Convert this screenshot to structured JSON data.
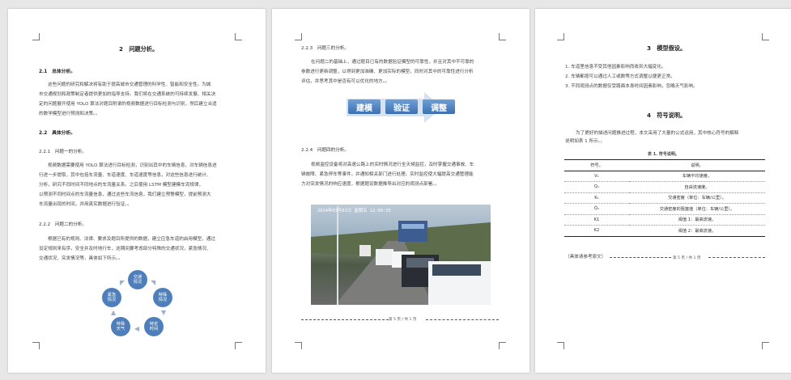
{
  "page1": {
    "h_analysis": "2　问题分析。",
    "s21": "2.1　总体分析。",
    "s21_lines": [
      "这些问题的研究和解决将有助于提高城市交通管理的科学性、智能和安全性。为城",
      "市交通规划和政策制定者提供更加的指导支持。我们将在交通系统的可持续发展、相关决",
      "定的问题展开使用 YOLO 算法对题目附录的视频数据进行目标检测与识别，然后建立合适",
      "的数学模型进行预测和决策。。"
    ],
    "s22": "2.2　具体分析。",
    "s221": "2.2.1　问题一的分析。",
    "s221_lines": [
      "视频数据需要使用 YOLO 算法进行目标检测，识别出其中的车辆信息，对车辆信息进",
      "行进一步提取，其中包括车流量、车道速度、车道速度等信息，对这些信息进行统计、",
      "分析，研究不同时间不同地点的车流量关系。之后使用 LSTM 模型建模车流规律，",
      "以预测不同时间点的车流量信息，通过这些车流信息，我们建立预警模型，提前预测大",
      "车流量出现的时间，并用真实数据进行验证。。"
    ],
    "s222": "2.2.2　问题二的分析。",
    "s222_lines": [
      "根据已有的规则、法律、要求及题目所提供的数据，建立应急车道的启用模型，通过",
      "设定规则来有序，安全并及时地行车，这期间要考虑部分特殊的交通状况，紧急情况、",
      "交通状况、突发情况等，具体如下所示。。"
    ],
    "cycle": [
      {
        "label": "交通\n情况"
      },
      {
        "label": "特殊\n情况"
      },
      {
        "label": "特定\n时间"
      },
      {
        "label": "特殊\n天气"
      },
      {
        "label": "紧急\n情况"
      }
    ]
  },
  "page2": {
    "s223": "2.2.3　问题三的分析。",
    "s223_lines": [
      "在问题二的基础上，通过题目已有的数据验证模型的可靠性，并且对其中不可靠的",
      "参数进行更新调整，以得到更加准确、更加实际的模型，同时对其中的可靠性进行分析",
      "评估，并思考其中是否有可以优化的地方。。"
    ],
    "flow": [
      "建模",
      "验证",
      "调整"
    ],
    "s224": "2.2.4　问题四的分析。",
    "s224_lines": [
      "视频监控设备将对高速公路上的实时情况进行全天候监控，及时掌握交通事故、车",
      "辆故障、紧急停车等事件，并通知相关部门进行处理。实时监控使大幅提高交通管理能",
      "力对突发情况的响应速度，根据题设数据推导出对应的观测点部署。。"
    ],
    "photo_stamp": "2024年03月01日 星期五 12:09:35",
    "footer": "第 5 页 / 共 1 页"
  },
  "page3": {
    "h_assume": "3　模型假设。",
    "assumptions": [
      "1. 车道里信息不受其他因素影响而收到大幅变化。",
      "2. 车辆都按可以通过人工或数等方式调整以便更正常。",
      "3. 不同观测点的数据仅受路面本身时间因素影响，忽略天气影响。"
    ],
    "h_symbol": "4　符号说明。",
    "symbol_intro": [
      "为了更好的描述问题推进过程，本文采用了大量的公式运用，其中核心符号的解释",
      "说明如表 1 所示。。"
    ],
    "table_caption": "表 1. 符号说明。",
    "table_header": [
      "符号。",
      "说明。"
    ],
    "table_rows": [
      [
        "V₁",
        "车辆平均速度。"
      ],
      [
        "Q₁",
        "自由流速度。"
      ],
      [
        "K₁",
        "交通密度（单位：车辆/公里）。"
      ],
      [
        "Q̃₁",
        "交通密度的阻塞值（单位：车辆/公里）。"
      ],
      [
        "K1",
        "阈值 1：最高流速。"
      ],
      [
        "K2",
        "阈值 2：最高流速。"
      ]
    ],
    "note": "（具体请参考原文）",
    "footer": "第 5 页 / 共 1 页"
  }
}
